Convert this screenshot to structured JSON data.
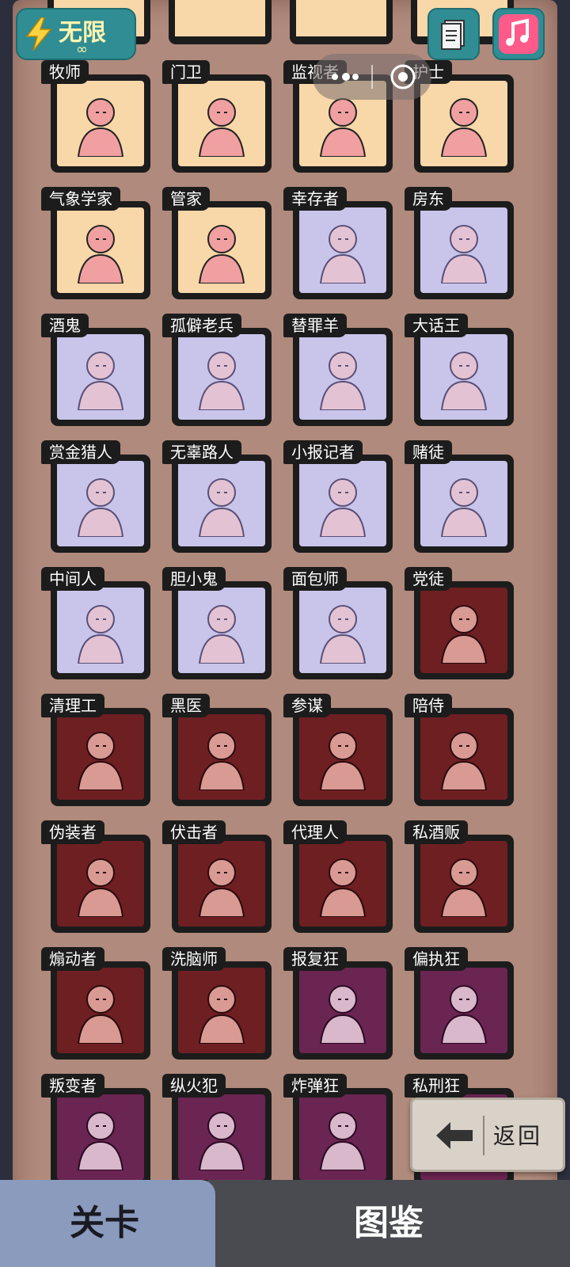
{
  "energy": {
    "label": "无限",
    "sub": "∞",
    "icon": "lightning-icon"
  },
  "top_buttons": {
    "doc_icon": "document-icon",
    "music_icon": "music-note-icon"
  },
  "colors": {
    "townsfolk": "#f8d7a8",
    "outsider": "#c8c4ea",
    "minion": "#6e1f22",
    "demon_team": "#6a2552"
  },
  "cards": [
    {
      "label": "牧师",
      "color": "cream",
      "icon": "priest-figure-icon"
    },
    {
      "label": "门卫",
      "color": "cream",
      "icon": "gatehouse-icon"
    },
    {
      "label": "监视者",
      "color": "cream",
      "icon": "eye-icon"
    },
    {
      "label": "护士",
      "color": "cream",
      "icon": "nurse-cap-icon"
    },
    {
      "label": "气象学家",
      "color": "cream",
      "icon": "sun-cloud-icon"
    },
    {
      "label": "管家",
      "color": "cream",
      "icon": "serving-tray-icon"
    },
    {
      "label": "幸存者",
      "color": "lav",
      "icon": "crouching-figure-icon"
    },
    {
      "label": "房东",
      "color": "lav",
      "icon": "keys-figure-icon"
    },
    {
      "label": "酒鬼",
      "color": "lav",
      "icon": "drunk-portrait-icon"
    },
    {
      "label": "孤僻老兵",
      "color": "lav",
      "icon": "veteran-figure-icon"
    },
    {
      "label": "替罪羊",
      "color": "lav",
      "icon": "ram-figure-icon"
    },
    {
      "label": "大话王",
      "color": "lav",
      "icon": "liar-portrait-icon"
    },
    {
      "label": "赏金猎人",
      "color": "lav",
      "icon": "hunter-portrait-icon"
    },
    {
      "label": "无辜路人",
      "color": "lav",
      "icon": "bystander-figure-icon"
    },
    {
      "label": "小报记者",
      "color": "lav",
      "icon": "reporter-portrait-icon"
    },
    {
      "label": "赌徒",
      "color": "lav",
      "icon": "gambler-figure-icon"
    },
    {
      "label": "中间人",
      "color": "lav",
      "icon": "broker-portrait-icon"
    },
    {
      "label": "胆小鬼",
      "color": "lav",
      "icon": "coward-portrait-icon"
    },
    {
      "label": "面包师",
      "color": "lav",
      "icon": "bread-icon"
    },
    {
      "label": "党徒",
      "color": "maroon",
      "icon": "partisan-portrait-icon"
    },
    {
      "label": "清理工",
      "color": "maroon",
      "icon": "cleaner-figure-icon"
    },
    {
      "label": "黑医",
      "color": "maroon",
      "icon": "doctor-portrait-icon"
    },
    {
      "label": "参谋",
      "color": "maroon",
      "icon": "advisor-figure-icon"
    },
    {
      "label": "陪侍",
      "color": "maroon",
      "icon": "escort-portrait-icon"
    },
    {
      "label": "伪装者",
      "color": "maroon",
      "icon": "disguise-figure-icon"
    },
    {
      "label": "伏击者",
      "color": "maroon",
      "icon": "door-ambush-icon"
    },
    {
      "label": "代理人",
      "color": "maroon",
      "icon": "agent-portrait-icon"
    },
    {
      "label": "私酒贩",
      "color": "maroon",
      "icon": "bootlegger-figure-icon"
    },
    {
      "label": "煽动者",
      "color": "maroon",
      "icon": "agitator-figure-icon"
    },
    {
      "label": "洗脑师",
      "color": "maroon",
      "icon": "pocket-watch-icon"
    },
    {
      "label": "报复狂",
      "color": "purple",
      "icon": "avenger-figure-icon"
    },
    {
      "label": "偏执狂",
      "color": "purple",
      "icon": "paranoid-portrait-icon"
    },
    {
      "label": "叛变者",
      "color": "purple",
      "icon": "traitor-figure-icon"
    },
    {
      "label": "纵火犯",
      "color": "purple",
      "icon": "arsonist-portrait-icon"
    },
    {
      "label": "炸弹狂",
      "color": "purple",
      "icon": "bomber-figure-icon"
    },
    {
      "label": "私刑狂",
      "color": "purple",
      "icon": "lyncher-figure-icon"
    }
  ],
  "back_button": {
    "label": "返回",
    "icon": "arrow-left-icon"
  },
  "tabs": [
    {
      "label": "关卡",
      "active": false
    },
    {
      "label": "图鉴",
      "active": true
    }
  ]
}
